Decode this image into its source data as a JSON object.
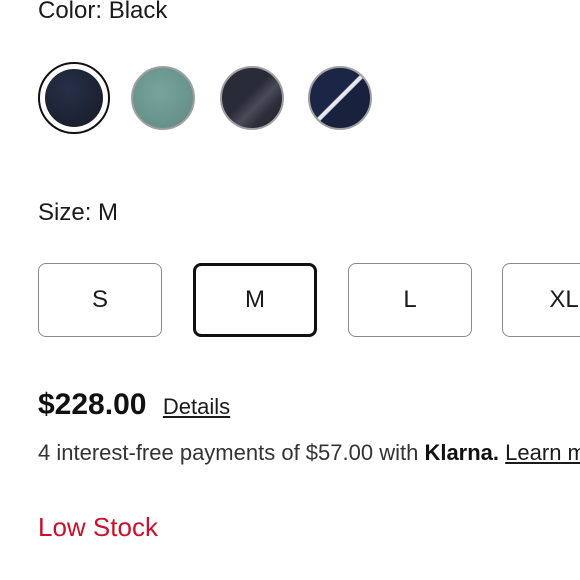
{
  "color": {
    "label": "Color: Black",
    "swatches": [
      {
        "name": "black",
        "color": "#1c2333",
        "selected": true
      },
      {
        "name": "teal-grey",
        "color": "#6b9690",
        "selected": false
      },
      {
        "name": "charcoal",
        "color": "#2c2d3a",
        "selected": false
      },
      {
        "name": "navy-stripe",
        "color": "#1b2545",
        "selected": false
      }
    ]
  },
  "size": {
    "label": "Size: M",
    "options": [
      "S",
      "M",
      "L",
      "XL"
    ],
    "selected": "M"
  },
  "price": {
    "amount": "$228.00",
    "details_label": "Details"
  },
  "installments": {
    "prefix": "4 interest-free payments of $57.00 with ",
    "provider": "Klarna.",
    "link_label": "Learn more"
  },
  "stock": {
    "status": "Low Stock",
    "color": "#c8102e"
  }
}
